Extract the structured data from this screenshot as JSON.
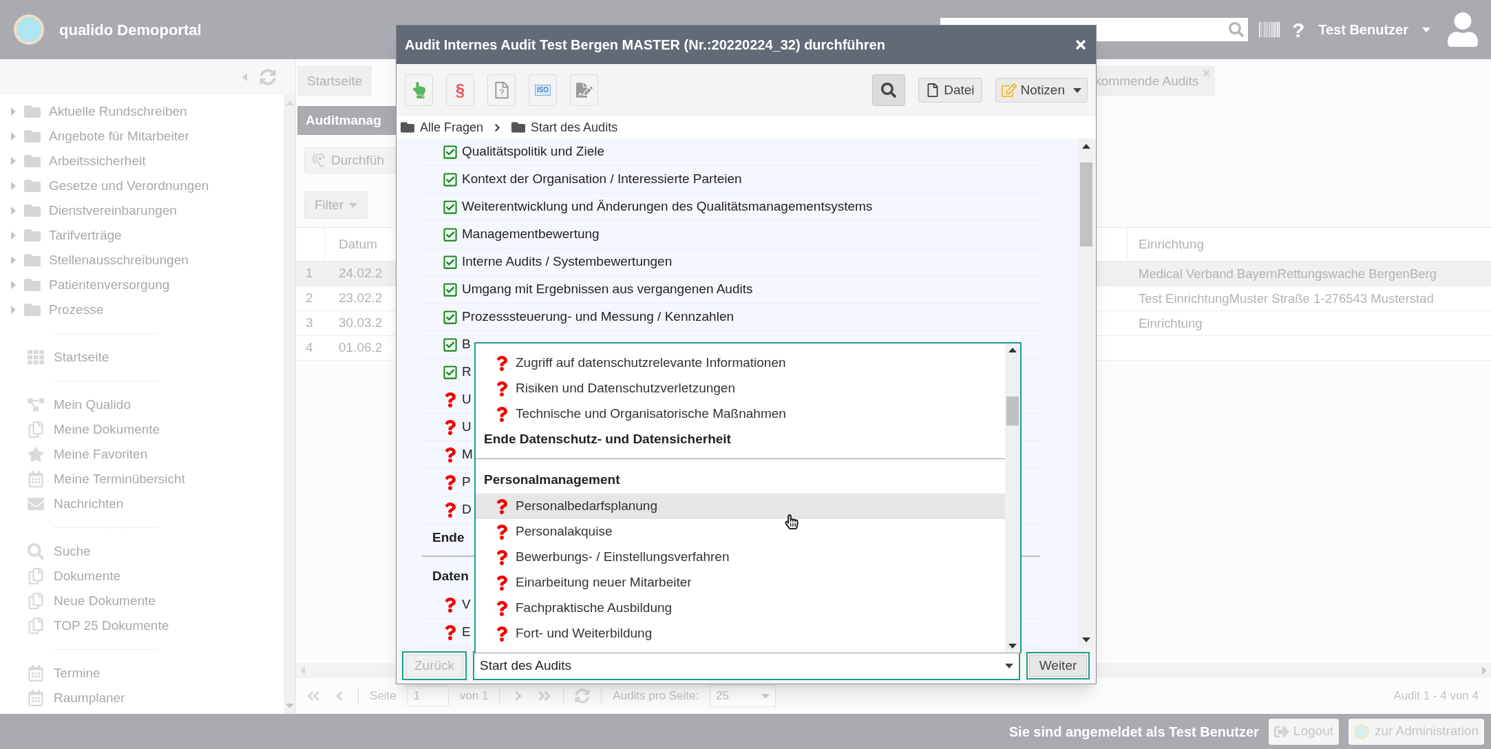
{
  "header": {
    "title": "qualido Demoportal",
    "help": "?",
    "user": "Test Benutzer"
  },
  "sidebar": {
    "tree": [
      {
        "label": "Aktuelle Rundschreiben"
      },
      {
        "label": "Angebote für Mitarbeiter"
      },
      {
        "label": "Arbeitssicherheit"
      },
      {
        "label": "Gesetze und Verordnungen"
      },
      {
        "label": "Dienstvereinbarungen"
      },
      {
        "label": "Tarifverträge"
      },
      {
        "label": "Stellenausschreibungen"
      },
      {
        "label": "Patientenversorgung"
      },
      {
        "label": "Prozesse"
      }
    ],
    "groups": [
      [
        {
          "label": "Startseite",
          "kind": "grid"
        }
      ],
      [
        {
          "label": "Mein Qualido",
          "kind": "network"
        },
        {
          "label": "Meine Dokumente",
          "kind": "documents"
        },
        {
          "label": "Meine Favoriten",
          "kind": "star"
        },
        {
          "label": "Meine Terminübersicht",
          "kind": "calendar"
        },
        {
          "label": "Nachrichten",
          "kind": "mail"
        }
      ],
      [
        {
          "label": "Suche",
          "kind": "search"
        },
        {
          "label": "Dokumente",
          "kind": "documents"
        },
        {
          "label": "Neue Dokumente",
          "kind": "documents"
        },
        {
          "label": "TOP 25 Dokumente",
          "kind": "documents"
        }
      ],
      [
        {
          "label": "Termine",
          "kind": "calendar"
        },
        {
          "label": "Raumplaner",
          "kind": "calendar"
        }
      ]
    ]
  },
  "tabs": [
    {
      "label": "Startseite",
      "closable": false
    },
    {
      "label": "kommende Audits",
      "closable": true
    }
  ],
  "page": {
    "heading": "Auditmanag",
    "action": "Durchfüh",
    "filter": "Filter",
    "table": {
      "columns": [
        {
          "label": "Datum"
        },
        {
          "label": "Einrichtung"
        }
      ],
      "rows": [
        {
          "number": "1",
          "date": "24.02.2",
          "facility": "Medical Verband BayernRettungswache BergenBerg",
          "selected": true
        },
        {
          "number": "2",
          "date": "23.02.2",
          "facility": "Test EinrichtungMuster Straße 1-276543 Musterstad",
          "selected": false
        },
        {
          "number": "3",
          "date": "30.03.2",
          "facility": "Einrichtung",
          "selected": false
        },
        {
          "number": "4",
          "date": "01.06.2",
          "selected": false
        }
      ]
    },
    "pager": {
      "page_label": "Seite",
      "page": "1",
      "of": "von 1",
      "per_page_label": "Audits pro Seite:",
      "per_page": "25",
      "summary": "Audit 1 - 4 von 4"
    }
  },
  "footer": {
    "login_text": "Sie sind angemeldet als **Test Benutzer**",
    "logout": "Logout",
    "admin": "zur Administration"
  },
  "modal": {
    "title": "Audit Internes Audit Test Bergen MASTER (Nr.:20220224_32) durchführen",
    "tools": [
      {
        "kind": "hand"
      },
      {
        "kind": "paragraph",
        "label": "§"
      },
      {
        "kind": "document-question"
      },
      {
        "kind": "iso",
        "label": "ISO"
      },
      {
        "kind": "checklist"
      }
    ],
    "file_button": "Datei",
    "notes_button": "Notizen",
    "breadcrumb": [
      "Alle Fragen",
      "Start des Audits"
    ],
    "questions": [
      {
        "kind": "question",
        "label": "Qualitätspolitik und Ziele",
        "done": true
      },
      {
        "kind": "question",
        "label": "Kontext der Organisation / Interessierte Parteien",
        "done": true
      },
      {
        "kind": "question",
        "label": "Weiterentwicklung und Änderungen des Qualitätsmanagementsystems",
        "done": true
      },
      {
        "kind": "question",
        "label": "Managementbewertung",
        "done": true
      },
      {
        "kind": "question",
        "label": "Interne Audits / Systembewertungen",
        "done": true
      },
      {
        "kind": "question",
        "label": "Umgang mit Ergebnissen aus vergangenen Audits",
        "done": true
      },
      {
        "kind": "question",
        "label": "Prozesssteuerung- und Messung / Kennzahlen",
        "done": true
      },
      {
        "kind": "question",
        "label": "B",
        "done": true
      },
      {
        "kind": "question",
        "label": "R",
        "done": true
      },
      {
        "kind": "question",
        "label": "U",
        "done": false
      },
      {
        "kind": "question",
        "label": "U",
        "done": false
      },
      {
        "kind": "question",
        "label": "M",
        "done": false
      },
      {
        "kind": "question",
        "label": "P",
        "done": false
      },
      {
        "kind": "question",
        "label": "D",
        "done": false
      },
      {
        "kind": "section_end",
        "label": "Ende"
      },
      {
        "kind": "divider"
      },
      {
        "kind": "section",
        "label": "Daten"
      },
      {
        "kind": "question",
        "label": "V",
        "done": false
      },
      {
        "kind": "question",
        "label": "E",
        "done": false
      }
    ],
    "back_button": {
      "label": "Zurück",
      "disabled": true
    },
    "next_button": {
      "label": "Weiter",
      "disabled": false
    },
    "select": {
      "value": "Start des Audits",
      "open": true,
      "options": [
        {
          "kind": "question",
          "label": "Zugriff auf datenschutzrelevante Informationen",
          "selected": false
        },
        {
          "kind": "question",
          "label": "Risiken und Datenschutzverletzungen",
          "selected": false
        },
        {
          "kind": "question",
          "label": "Technische und Organisatorische Maßnahmen",
          "selected": false
        },
        {
          "kind": "section_end",
          "label": "Ende Datenschutz- und Datensicherheit"
        },
        {
          "kind": "divider"
        },
        {
          "kind": "section",
          "label": "Personalmanagement"
        },
        {
          "kind": "question",
          "label": "Personalbedarfsplanung",
          "selected": true
        },
        {
          "kind": "question",
          "label": "Personalakquise",
          "selected": false
        },
        {
          "kind": "question",
          "label": "Bewerbungs- / Einstellungsverfahren",
          "selected": false
        },
        {
          "kind": "question",
          "label": "Einarbeitung neuer Mitarbeiter",
          "selected": false
        },
        {
          "kind": "question",
          "label": "Fachpraktische Ausbildung",
          "selected": false
        },
        {
          "kind": "question",
          "label": "Fort- und Weiterbildung",
          "selected": false
        }
      ]
    }
  }
}
